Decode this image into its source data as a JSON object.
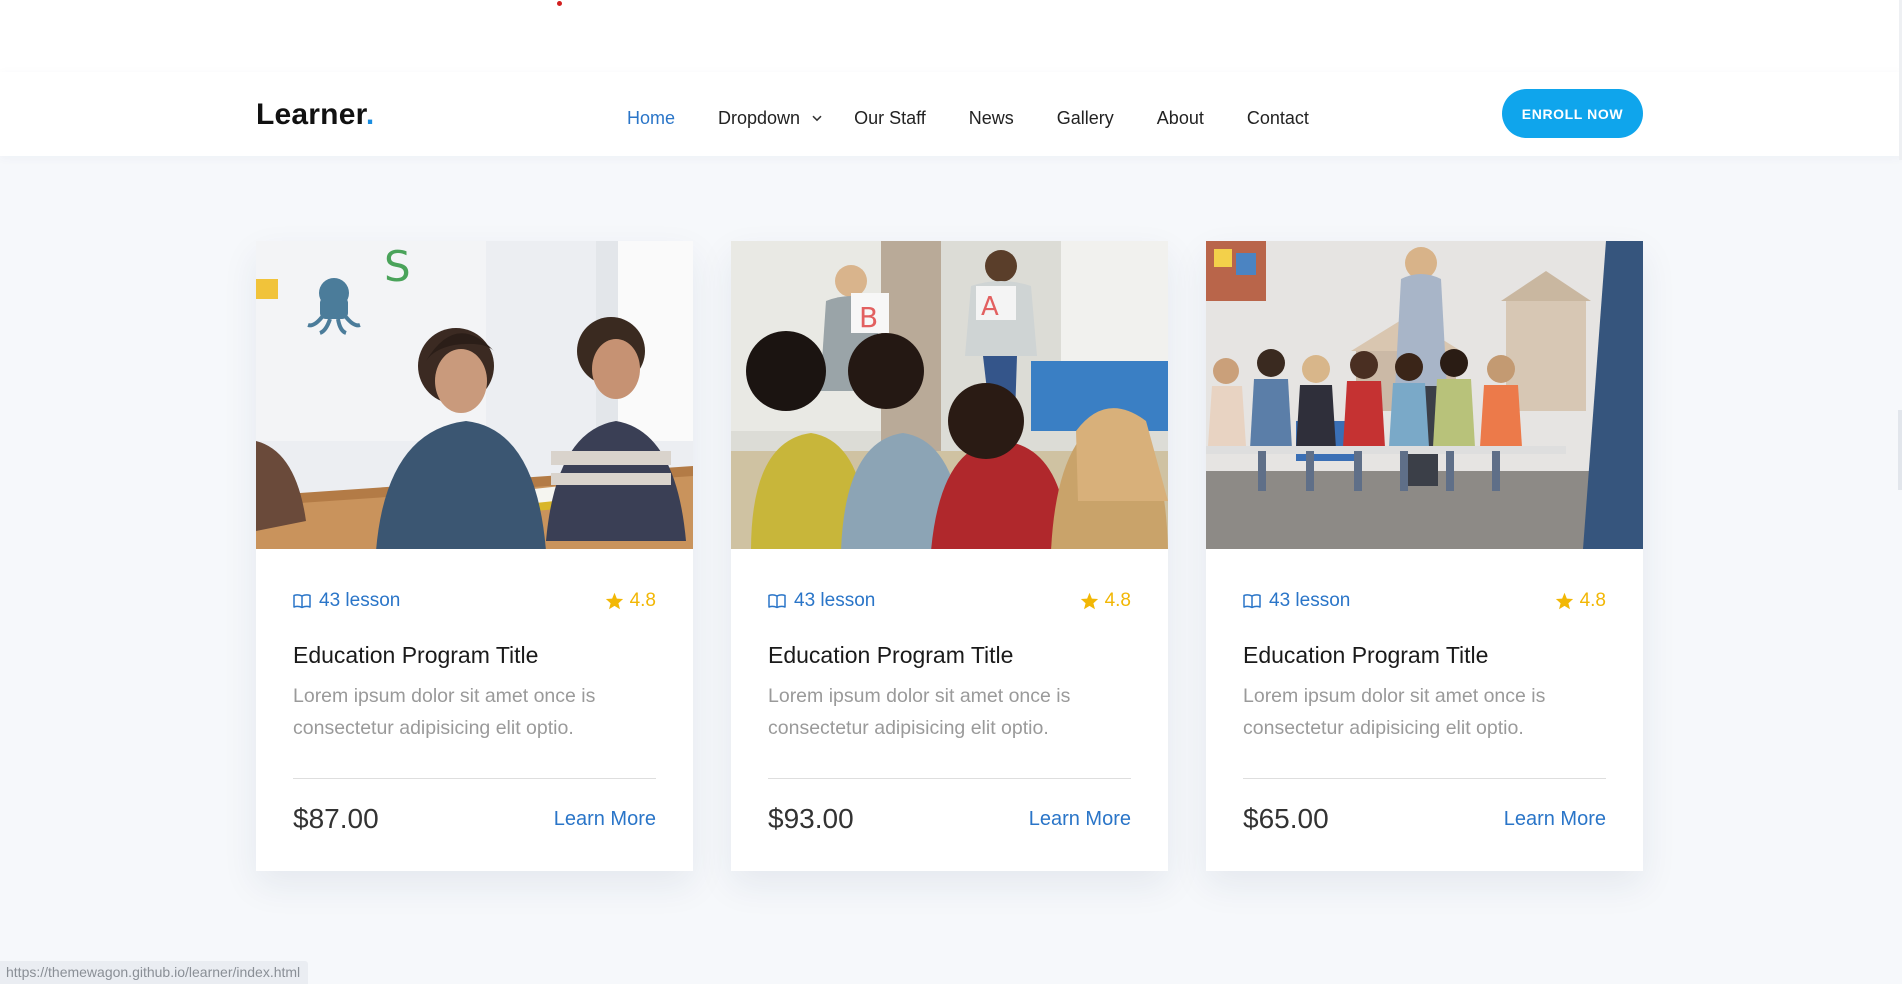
{
  "brand": {
    "name": "Learner",
    "dot": "."
  },
  "nav": {
    "items": [
      {
        "label": "Home",
        "active": true
      },
      {
        "label": "Dropdown",
        "has_dropdown": true
      },
      {
        "label": "Our Staff"
      },
      {
        "label": "News"
      },
      {
        "label": "Gallery"
      },
      {
        "label": "About"
      },
      {
        "label": "Contact"
      }
    ],
    "cta_label": "ENROLL NOW"
  },
  "cards": [
    {
      "image": "children-drawing-at-table-photo",
      "lessons": "43 lesson",
      "rating": "4.8",
      "title": "Education Program Title",
      "description": "Lorem ipsum dolor sit amet once is consectetur adipisicing elit optio.",
      "price": "$87.00",
      "link_label": "Learn More"
    },
    {
      "image": "teachers-showing-letter-cards-photo",
      "lessons": "43 lesson",
      "rating": "4.8",
      "title": "Education Program Title",
      "description": "Lorem ipsum dolor sit amet once is consectetur adipisicing elit optio.",
      "price": "$93.00",
      "link_label": "Learn More"
    },
    {
      "image": "children-seated-in-row-with-teachers-photo",
      "lessons": "43 lesson",
      "rating": "4.8",
      "title": "Education Program Title",
      "description": "Lorem ipsum dolor sit amet once is consectetur adipisicing elit optio.",
      "price": "$65.00",
      "link_label": "Learn More"
    }
  ],
  "status_bar": {
    "url": "https://themewagon.github.io/learner/index.html"
  },
  "colors": {
    "accent_blue": "#2a75c8",
    "button_blue": "#0fa5ec",
    "star_gold": "#f2b705",
    "page_bg": "#f6f8fb"
  }
}
